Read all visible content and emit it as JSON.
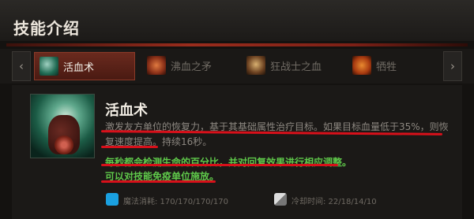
{
  "header": {
    "title": "技能介绍"
  },
  "nav": {
    "prev_arrow": "‹",
    "next_arrow": "›"
  },
  "tabs": [
    {
      "label": "活血术",
      "icon": "heal-skill-icon",
      "active": true
    },
    {
      "label": "沸血之矛",
      "icon": "burning-spear-icon",
      "active": false
    },
    {
      "label": "狂战士之血",
      "icon": "berserkers-blood-icon",
      "active": false
    },
    {
      "label": "牺牲",
      "icon": "sacrifice-icon",
      "active": false
    }
  ],
  "skill": {
    "name": "活血术",
    "description": "激发友方单位的恢复力，基于其基础属性治疗目标。如果目标血量低于35%，则恢复速度提高。持续16秒。",
    "note1": "每秒都会检测生命的百分比，并对回复效果进行相应调整。",
    "note2": "可以对技能免疫单位施放。",
    "mana": "魔法消耗: 170/170/170/170",
    "cooldown": "冷却时间: 22/18/14/10"
  },
  "colors": {
    "accent": "#9a2c1c",
    "highlight_text": "#5fc84a",
    "annotation": "#d8101a",
    "mana": "#1aa0e0"
  }
}
